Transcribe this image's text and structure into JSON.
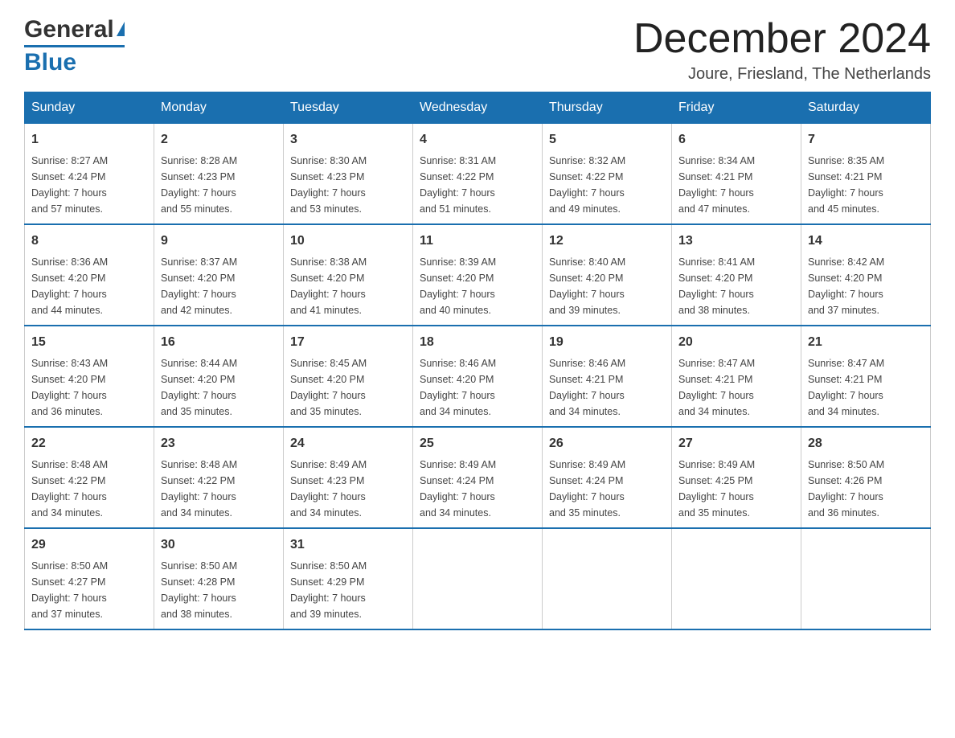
{
  "header": {
    "logo_general": "General",
    "logo_blue": "Blue",
    "month_title": "December 2024",
    "location": "Joure, Friesland, The Netherlands"
  },
  "days_of_week": [
    "Sunday",
    "Monday",
    "Tuesday",
    "Wednesday",
    "Thursday",
    "Friday",
    "Saturday"
  ],
  "weeks": [
    [
      {
        "day": "1",
        "info": "Sunrise: 8:27 AM\nSunset: 4:24 PM\nDaylight: 7 hours\nand 57 minutes."
      },
      {
        "day": "2",
        "info": "Sunrise: 8:28 AM\nSunset: 4:23 PM\nDaylight: 7 hours\nand 55 minutes."
      },
      {
        "day": "3",
        "info": "Sunrise: 8:30 AM\nSunset: 4:23 PM\nDaylight: 7 hours\nand 53 minutes."
      },
      {
        "day": "4",
        "info": "Sunrise: 8:31 AM\nSunset: 4:22 PM\nDaylight: 7 hours\nand 51 minutes."
      },
      {
        "day": "5",
        "info": "Sunrise: 8:32 AM\nSunset: 4:22 PM\nDaylight: 7 hours\nand 49 minutes."
      },
      {
        "day": "6",
        "info": "Sunrise: 8:34 AM\nSunset: 4:21 PM\nDaylight: 7 hours\nand 47 minutes."
      },
      {
        "day": "7",
        "info": "Sunrise: 8:35 AM\nSunset: 4:21 PM\nDaylight: 7 hours\nand 45 minutes."
      }
    ],
    [
      {
        "day": "8",
        "info": "Sunrise: 8:36 AM\nSunset: 4:20 PM\nDaylight: 7 hours\nand 44 minutes."
      },
      {
        "day": "9",
        "info": "Sunrise: 8:37 AM\nSunset: 4:20 PM\nDaylight: 7 hours\nand 42 minutes."
      },
      {
        "day": "10",
        "info": "Sunrise: 8:38 AM\nSunset: 4:20 PM\nDaylight: 7 hours\nand 41 minutes."
      },
      {
        "day": "11",
        "info": "Sunrise: 8:39 AM\nSunset: 4:20 PM\nDaylight: 7 hours\nand 40 minutes."
      },
      {
        "day": "12",
        "info": "Sunrise: 8:40 AM\nSunset: 4:20 PM\nDaylight: 7 hours\nand 39 minutes."
      },
      {
        "day": "13",
        "info": "Sunrise: 8:41 AM\nSunset: 4:20 PM\nDaylight: 7 hours\nand 38 minutes."
      },
      {
        "day": "14",
        "info": "Sunrise: 8:42 AM\nSunset: 4:20 PM\nDaylight: 7 hours\nand 37 minutes."
      }
    ],
    [
      {
        "day": "15",
        "info": "Sunrise: 8:43 AM\nSunset: 4:20 PM\nDaylight: 7 hours\nand 36 minutes."
      },
      {
        "day": "16",
        "info": "Sunrise: 8:44 AM\nSunset: 4:20 PM\nDaylight: 7 hours\nand 35 minutes."
      },
      {
        "day": "17",
        "info": "Sunrise: 8:45 AM\nSunset: 4:20 PM\nDaylight: 7 hours\nand 35 minutes."
      },
      {
        "day": "18",
        "info": "Sunrise: 8:46 AM\nSunset: 4:20 PM\nDaylight: 7 hours\nand 34 minutes."
      },
      {
        "day": "19",
        "info": "Sunrise: 8:46 AM\nSunset: 4:21 PM\nDaylight: 7 hours\nand 34 minutes."
      },
      {
        "day": "20",
        "info": "Sunrise: 8:47 AM\nSunset: 4:21 PM\nDaylight: 7 hours\nand 34 minutes."
      },
      {
        "day": "21",
        "info": "Sunrise: 8:47 AM\nSunset: 4:21 PM\nDaylight: 7 hours\nand 34 minutes."
      }
    ],
    [
      {
        "day": "22",
        "info": "Sunrise: 8:48 AM\nSunset: 4:22 PM\nDaylight: 7 hours\nand 34 minutes."
      },
      {
        "day": "23",
        "info": "Sunrise: 8:48 AM\nSunset: 4:22 PM\nDaylight: 7 hours\nand 34 minutes."
      },
      {
        "day": "24",
        "info": "Sunrise: 8:49 AM\nSunset: 4:23 PM\nDaylight: 7 hours\nand 34 minutes."
      },
      {
        "day": "25",
        "info": "Sunrise: 8:49 AM\nSunset: 4:24 PM\nDaylight: 7 hours\nand 34 minutes."
      },
      {
        "day": "26",
        "info": "Sunrise: 8:49 AM\nSunset: 4:24 PM\nDaylight: 7 hours\nand 35 minutes."
      },
      {
        "day": "27",
        "info": "Sunrise: 8:49 AM\nSunset: 4:25 PM\nDaylight: 7 hours\nand 35 minutes."
      },
      {
        "day": "28",
        "info": "Sunrise: 8:50 AM\nSunset: 4:26 PM\nDaylight: 7 hours\nand 36 minutes."
      }
    ],
    [
      {
        "day": "29",
        "info": "Sunrise: 8:50 AM\nSunset: 4:27 PM\nDaylight: 7 hours\nand 37 minutes."
      },
      {
        "day": "30",
        "info": "Sunrise: 8:50 AM\nSunset: 4:28 PM\nDaylight: 7 hours\nand 38 minutes."
      },
      {
        "day": "31",
        "info": "Sunrise: 8:50 AM\nSunset: 4:29 PM\nDaylight: 7 hours\nand 39 minutes."
      },
      {
        "day": "",
        "info": ""
      },
      {
        "day": "",
        "info": ""
      },
      {
        "day": "",
        "info": ""
      },
      {
        "day": "",
        "info": ""
      }
    ]
  ],
  "colors": {
    "header_bg": "#1a6faf",
    "header_text": "#ffffff",
    "border": "#1a6faf",
    "text": "#333333"
  }
}
